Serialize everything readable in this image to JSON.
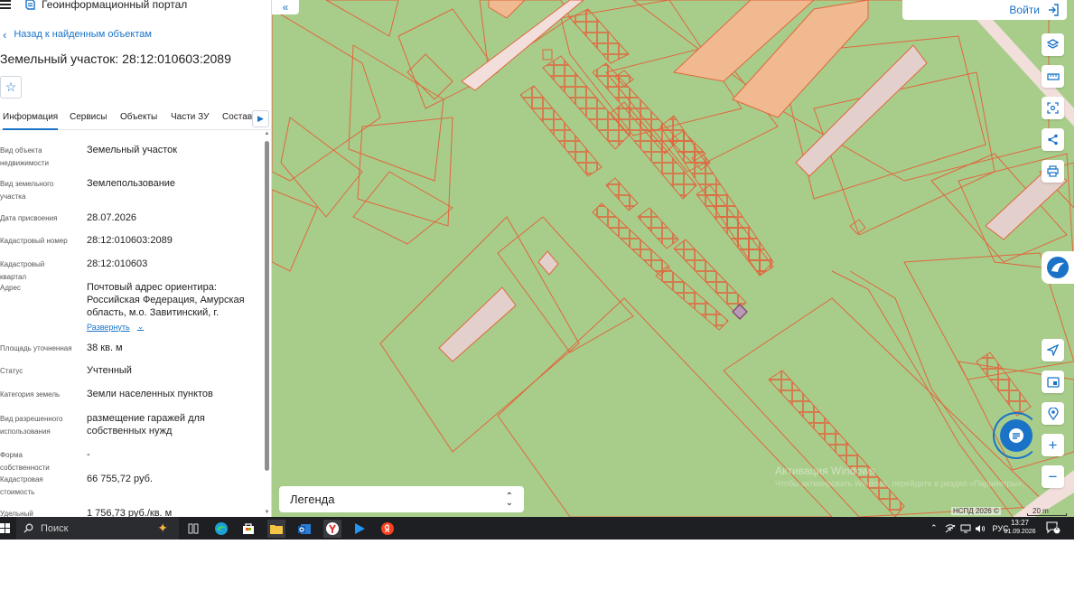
{
  "header": {
    "portal_title": "Геоинформационный портал"
  },
  "nav": {
    "back_label": "Назад к найденным объектам"
  },
  "object": {
    "title": "Земельный участок: 28:12:010603:2089"
  },
  "tabs": [
    {
      "label": "Информация",
      "active": true
    },
    {
      "label": "Сервисы"
    },
    {
      "label": "Объекты"
    },
    {
      "label": "Части ЗУ"
    },
    {
      "label": "Состав"
    }
  ],
  "properties": [
    {
      "label_lines": [
        "Вид объекта",
        "недвижимости"
      ],
      "value": "Земельный участок"
    },
    {
      "label_lines": [
        "Вид земельного",
        "участка"
      ],
      "value": "Землепользование"
    },
    {
      "label_lines": [
        "Дата присвоения"
      ],
      "value": "28.07.2026"
    },
    {
      "label_lines": [
        "Кадастровый номер"
      ],
      "value": "28:12:010603:2089"
    },
    {
      "label_lines": [
        "Кадастровый квартал"
      ],
      "value": "28:12:010603"
    },
    {
      "label_lines": [
        "Адрес"
      ],
      "value": "Почтовый адрес ориентира: Российская Федерация, Амурская область, м.о. Завитинский, г."
    },
    {
      "label_lines": [
        "Площадь уточненная"
      ],
      "value": "38 кв. м"
    },
    {
      "label_lines": [
        "Статус"
      ],
      "value": "Учтенный"
    },
    {
      "label_lines": [
        "Категория земель"
      ],
      "value": "Земли населенных пунктов"
    },
    {
      "label_lines": [
        "Вид разрешенного",
        "использования"
      ],
      "value": "размещение гаражей для собственных нужд"
    },
    {
      "label_lines": [
        "Форма собственности"
      ],
      "value": "-"
    },
    {
      "label_lines": [
        "Кадастровая",
        "стоимость"
      ],
      "value": "66 755,72 руб."
    },
    {
      "label_lines": [
        "Удельный показатель"
      ],
      "value": "1 756,73 руб./кв. м"
    }
  ],
  "expand_label": "Развернуть",
  "map": {
    "login_label": "Войти",
    "legend_label": "Легенда",
    "watermark_title": "Активация Windows",
    "watermark_text": "Чтобы активировать Windows, перейдите в раздел «Параметры».",
    "credit": "НСПД 2026 ©",
    "scale_label": "20 m",
    "tools": [
      "layers-icon",
      "ruler-icon",
      "select-area-icon",
      "share-icon",
      "print-icon",
      "locate-icon",
      "map-view-icon",
      "geo-pin-icon",
      "zoom-in-icon",
      "zoom-out-icon"
    ]
  },
  "taskbar": {
    "search_label": "Поиск",
    "lang": "РУС",
    "time": "13:27",
    "date": "01.09.2026",
    "notification_count": "2"
  },
  "colors": {
    "accent": "#1a73c7",
    "map_green": "#a8cd8a",
    "parcel_line": "#e0673f",
    "building_fill": "#f0b98f",
    "pale_building": "#e3cfcb",
    "taskbar": "#1e1f22"
  }
}
